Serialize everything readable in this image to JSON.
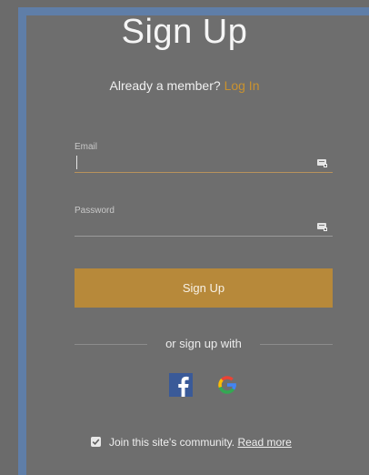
{
  "title": "Sign Up",
  "subtitle": {
    "prompt": "Already a member?",
    "login_link": "Log In"
  },
  "email": {
    "label": "Email",
    "value": "",
    "icon": "autofill-key-icon"
  },
  "password": {
    "label": "Password",
    "value": "",
    "icon": "autofill-key-icon"
  },
  "signup_button": "Sign Up",
  "divider_text": "or sign up with",
  "social": {
    "facebook": "facebook-icon",
    "google": "google-icon"
  },
  "community": {
    "checked": true,
    "text": "Join this site's community.",
    "read_more": "Read more"
  },
  "colors": {
    "background": "#6b6b6b",
    "panel_border": "#5f7ea8",
    "accent": "#b7893a",
    "link": "#c9922f"
  }
}
